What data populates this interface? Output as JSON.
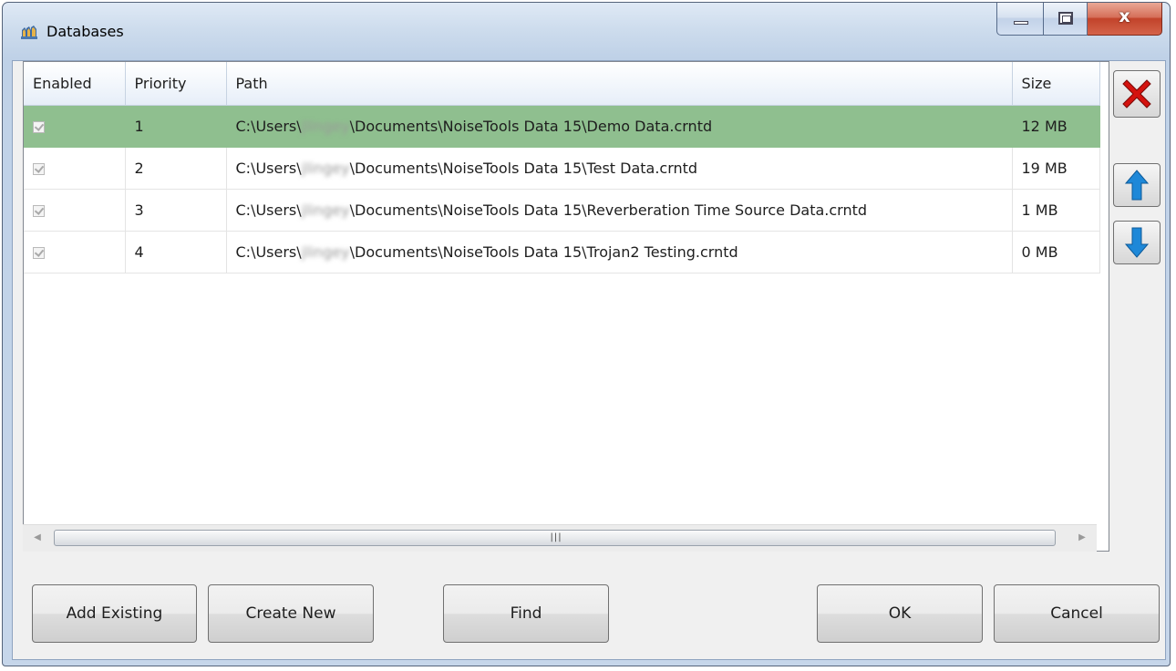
{
  "window": {
    "title": "Databases"
  },
  "grid": {
    "columns": [
      "Enabled",
      "Priority",
      "Path",
      "Size"
    ],
    "rows": [
      {
        "enabled": true,
        "priority": "1",
        "path_prefix": "C:\\Users\\",
        "path_user": "jlingey",
        "path_suffix": "\\Documents\\NoiseTools Data 15\\Demo Data.crntd",
        "size": "12 MB",
        "selected": true
      },
      {
        "enabled": true,
        "priority": "2",
        "path_prefix": "C:\\Users\\",
        "path_user": "jlingey",
        "path_suffix": "\\Documents\\NoiseTools Data 15\\Test Data.crntd",
        "size": "19 MB",
        "selected": false
      },
      {
        "enabled": true,
        "priority": "3",
        "path_prefix": "C:\\Users\\",
        "path_user": "jlingey",
        "path_suffix": "\\Documents\\NoiseTools Data 15\\Reverberation Time Source Data.crntd",
        "size": "1 MB",
        "selected": false
      },
      {
        "enabled": true,
        "priority": "4",
        "path_prefix": "C:\\Users\\",
        "path_user": "jlingey",
        "path_suffix": "\\Documents\\NoiseTools Data 15\\Trojan2 Testing.crntd",
        "size": "0 MB",
        "selected": false
      }
    ]
  },
  "buttons": {
    "add_existing": "Add Existing",
    "create_new": "Create New",
    "find": "Find",
    "ok": "OK",
    "cancel": "Cancel"
  },
  "icons": {
    "delete": "red-x-icon",
    "move_up": "arrow-up-icon",
    "move_down": "arrow-down-icon"
  },
  "colors": {
    "selected_row": "#8fbf8f",
    "delete_red": "#d4120e",
    "arrow_blue": "#1e88d8"
  }
}
